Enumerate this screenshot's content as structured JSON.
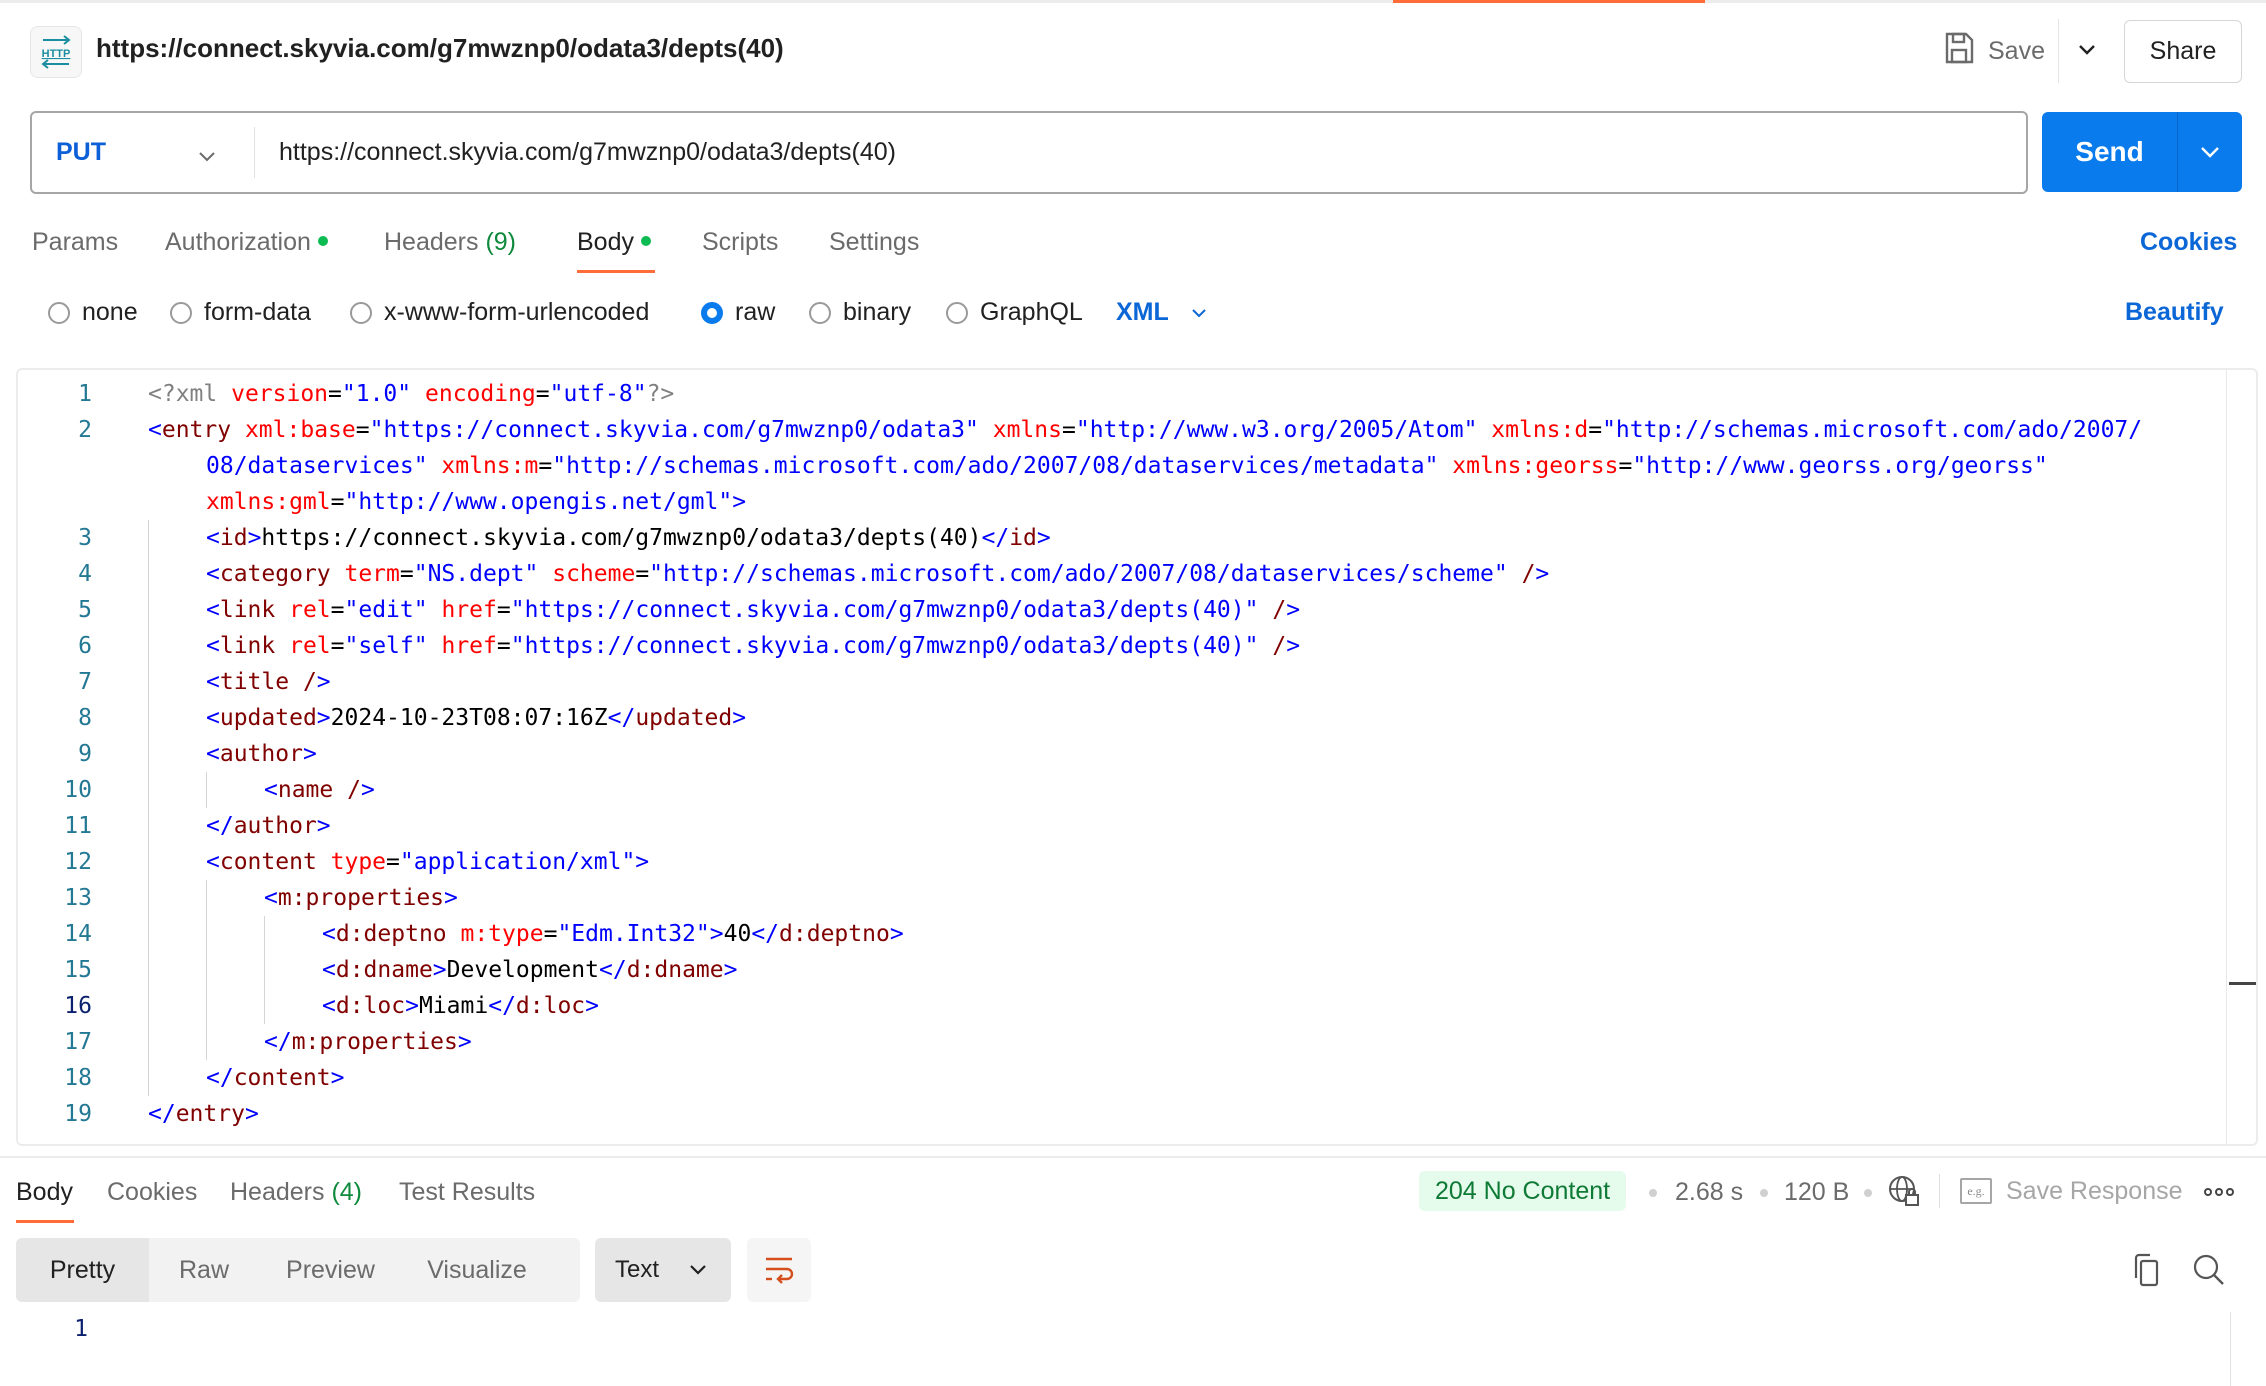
{
  "header": {
    "icon": "http-request-icon",
    "title": "https://connect.skyvia.com/g7mwznp0/odata3/depts(40)",
    "save_label": "Save",
    "share_label": "Share"
  },
  "request": {
    "method": "PUT",
    "url": "https://connect.skyvia.com/g7mwznp0/odata3/depts(40)",
    "send_label": "Send"
  },
  "tabs": {
    "params": "Params",
    "authorization": "Authorization",
    "headers": "Headers",
    "headers_count": "(9)",
    "body": "Body",
    "scripts": "Scripts",
    "settings": "Settings",
    "active": "Body",
    "cookies_link": "Cookies"
  },
  "body_types": {
    "options": [
      "none",
      "form-data",
      "x-www-form-urlencoded",
      "raw",
      "binary",
      "GraphQL"
    ],
    "selected": "raw",
    "language": "XML",
    "beautify_label": "Beautify"
  },
  "editor": {
    "current_line": 16,
    "lines": [
      {
        "n": "1",
        "indent": 0,
        "tokens": [
          [
            "pi",
            "<?xml "
          ],
          [
            "attr",
            "version"
          ],
          [
            "eq",
            "="
          ],
          [
            "val",
            "\"1.0\""
          ],
          [
            "pi",
            " "
          ],
          [
            "attr",
            "encoding"
          ],
          [
            "eq",
            "="
          ],
          [
            "val",
            "\"utf-8\""
          ],
          [
            "pi",
            "?>"
          ]
        ]
      },
      {
        "n": "2",
        "indent": 0,
        "tokens": [
          [
            "br",
            "<"
          ],
          [
            "tag",
            "entry "
          ],
          [
            "attr",
            "xml:base"
          ],
          [
            "eq",
            "="
          ],
          [
            "val",
            "\"https://connect.skyvia.com/g7mwznp0/odata3\""
          ],
          [
            "txt",
            " "
          ],
          [
            "attr",
            "xmlns"
          ],
          [
            "eq",
            "="
          ],
          [
            "val",
            "\"http://www.w3.org/2005/Atom\""
          ],
          [
            "txt",
            " "
          ],
          [
            "attr",
            "xmlns:d"
          ],
          [
            "eq",
            "="
          ],
          [
            "val",
            "\"http://schemas.microsoft.com/ado/2007/"
          ]
        ]
      },
      {
        "n": "",
        "indent": 1,
        "tokens": [
          [
            "val",
            "08/dataservices\""
          ],
          [
            "txt",
            " "
          ],
          [
            "attr",
            "xmlns:m"
          ],
          [
            "eq",
            "="
          ],
          [
            "val",
            "\"http://schemas.microsoft.com/ado/2007/08/dataservices/metadata\""
          ],
          [
            "txt",
            " "
          ],
          [
            "attr",
            "xmlns:georss"
          ],
          [
            "eq",
            "="
          ],
          [
            "val",
            "\"http://www.georss.org/georss\""
          ]
        ]
      },
      {
        "n": "",
        "indent": 1,
        "tokens": [
          [
            "attr",
            "xmlns:gml"
          ],
          [
            "eq",
            "="
          ],
          [
            "val",
            "\"http://www.opengis.net/gml\""
          ],
          [
            "br",
            ">"
          ]
        ]
      },
      {
        "n": "3",
        "indent": 1,
        "tokens": [
          [
            "br",
            "<"
          ],
          [
            "tag",
            "id"
          ],
          [
            "br",
            ">"
          ],
          [
            "txt",
            "https://connect.skyvia.com/g7mwznp0/odata3/depts(40)"
          ],
          [
            "br",
            "</"
          ],
          [
            "tag",
            "id"
          ],
          [
            "br",
            ">"
          ]
        ]
      },
      {
        "n": "4",
        "indent": 1,
        "tokens": [
          [
            "br",
            "<"
          ],
          [
            "tag",
            "category "
          ],
          [
            "attr",
            "term"
          ],
          [
            "eq",
            "="
          ],
          [
            "val",
            "\"NS.dept\""
          ],
          [
            "txt",
            " "
          ],
          [
            "attr",
            "scheme"
          ],
          [
            "eq",
            "="
          ],
          [
            "val",
            "\"http://schemas.microsoft.com/ado/2007/08/dataservices/scheme\""
          ],
          [
            "txt",
            " "
          ],
          [
            "tag",
            "/"
          ],
          [
            "br",
            ">"
          ]
        ]
      },
      {
        "n": "5",
        "indent": 1,
        "tokens": [
          [
            "br",
            "<"
          ],
          [
            "tag",
            "link "
          ],
          [
            "attr",
            "rel"
          ],
          [
            "eq",
            "="
          ],
          [
            "val",
            "\"edit\""
          ],
          [
            "txt",
            " "
          ],
          [
            "attr",
            "href"
          ],
          [
            "eq",
            "="
          ],
          [
            "val",
            "\"https://connect.skyvia.com/g7mwznp0/odata3/depts(40)\""
          ],
          [
            "txt",
            " "
          ],
          [
            "tag",
            "/"
          ],
          [
            "br",
            ">"
          ]
        ]
      },
      {
        "n": "6",
        "indent": 1,
        "tokens": [
          [
            "br",
            "<"
          ],
          [
            "tag",
            "link "
          ],
          [
            "attr",
            "rel"
          ],
          [
            "eq",
            "="
          ],
          [
            "val",
            "\"self\""
          ],
          [
            "txt",
            " "
          ],
          [
            "attr",
            "href"
          ],
          [
            "eq",
            "="
          ],
          [
            "val",
            "\"https://connect.skyvia.com/g7mwznp0/odata3/depts(40)\""
          ],
          [
            "txt",
            " "
          ],
          [
            "tag",
            "/"
          ],
          [
            "br",
            ">"
          ]
        ]
      },
      {
        "n": "7",
        "indent": 1,
        "tokens": [
          [
            "br",
            "<"
          ],
          [
            "tag",
            "title /"
          ],
          [
            "br",
            ">"
          ]
        ]
      },
      {
        "n": "8",
        "indent": 1,
        "tokens": [
          [
            "br",
            "<"
          ],
          [
            "tag",
            "updated"
          ],
          [
            "br",
            ">"
          ],
          [
            "txt",
            "2024-10-23T08:07:16Z"
          ],
          [
            "br",
            "</"
          ],
          [
            "tag",
            "updated"
          ],
          [
            "br",
            ">"
          ]
        ]
      },
      {
        "n": "9",
        "indent": 1,
        "tokens": [
          [
            "br",
            "<"
          ],
          [
            "tag",
            "author"
          ],
          [
            "br",
            ">"
          ]
        ]
      },
      {
        "n": "10",
        "indent": 2,
        "tokens": [
          [
            "br",
            "<"
          ],
          [
            "tag",
            "name /"
          ],
          [
            "br",
            ">"
          ]
        ]
      },
      {
        "n": "11",
        "indent": 1,
        "tokens": [
          [
            "br",
            "</"
          ],
          [
            "tag",
            "author"
          ],
          [
            "br",
            ">"
          ]
        ]
      },
      {
        "n": "12",
        "indent": 1,
        "tokens": [
          [
            "br",
            "<"
          ],
          [
            "tag",
            "content "
          ],
          [
            "attr",
            "type"
          ],
          [
            "eq",
            "="
          ],
          [
            "val",
            "\"application/xml\""
          ],
          [
            "br",
            ">"
          ]
        ]
      },
      {
        "n": "13",
        "indent": 2,
        "tokens": [
          [
            "br",
            "<"
          ],
          [
            "tag",
            "m:properties"
          ],
          [
            "br",
            ">"
          ]
        ]
      },
      {
        "n": "14",
        "indent": 3,
        "tokens": [
          [
            "br",
            "<"
          ],
          [
            "tag",
            "d:deptno "
          ],
          [
            "attr",
            "m:type"
          ],
          [
            "eq",
            "="
          ],
          [
            "val",
            "\"Edm.Int32\""
          ],
          [
            "br",
            ">"
          ],
          [
            "txt",
            "40"
          ],
          [
            "br",
            "</"
          ],
          [
            "tag",
            "d:deptno"
          ],
          [
            "br",
            ">"
          ]
        ]
      },
      {
        "n": "15",
        "indent": 3,
        "tokens": [
          [
            "br",
            "<"
          ],
          [
            "tag",
            "d:dname"
          ],
          [
            "br",
            ">"
          ],
          [
            "txt",
            "Development"
          ],
          [
            "br",
            "</"
          ],
          [
            "tag",
            "d:dname"
          ],
          [
            "br",
            ">"
          ]
        ]
      },
      {
        "n": "16",
        "indent": 3,
        "tokens": [
          [
            "br",
            "<"
          ],
          [
            "tag",
            "d:loc"
          ],
          [
            "br",
            ">"
          ],
          [
            "txt",
            "Miami"
          ],
          [
            "br",
            "</"
          ],
          [
            "tag",
            "d:loc"
          ],
          [
            "br",
            ">"
          ]
        ]
      },
      {
        "n": "17",
        "indent": 2,
        "tokens": [
          [
            "br",
            "</"
          ],
          [
            "tag",
            "m:properties"
          ],
          [
            "br",
            ">"
          ]
        ]
      },
      {
        "n": "18",
        "indent": 1,
        "tokens": [
          [
            "br",
            "</"
          ],
          [
            "tag",
            "content"
          ],
          [
            "br",
            ">"
          ]
        ]
      },
      {
        "n": "19",
        "indent": 0,
        "tokens": [
          [
            "br",
            "</"
          ],
          [
            "tag",
            "entry"
          ],
          [
            "br",
            ">"
          ]
        ]
      }
    ]
  },
  "response": {
    "tabs": {
      "body": "Body",
      "cookies": "Cookies",
      "headers": "Headers",
      "headers_count": "(4)",
      "test_results": "Test Results",
      "active": "Body"
    },
    "status": "204 No Content",
    "time": "2.68 s",
    "size": "120 B",
    "save_response_label": "Save Response",
    "eg_label": "e.g.",
    "views": [
      "Pretty",
      "Raw",
      "Preview",
      "Visualize"
    ],
    "active_view": "Pretty",
    "format": "Text",
    "body_lines": [
      "1"
    ]
  },
  "colors": {
    "accent_orange": "#ff6c37",
    "send_blue": "#097bed",
    "link_blue": "#0b66d6",
    "status_green": "#0f7a35",
    "status_bg": "#e5fbec"
  }
}
